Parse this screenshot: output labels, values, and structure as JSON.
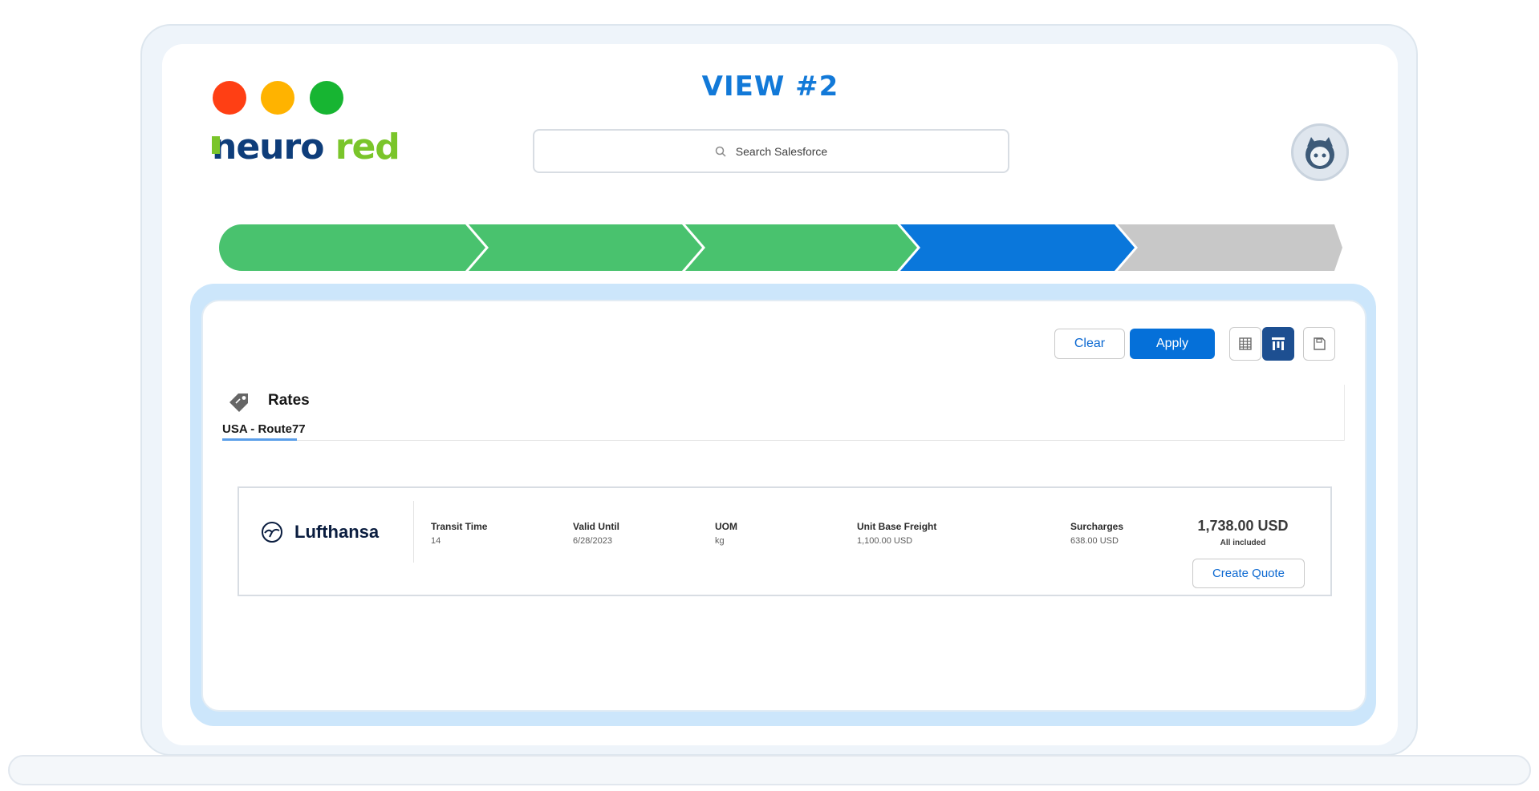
{
  "header": {
    "title": "VIEW #2",
    "logo_part1": "neuro",
    "logo_part2": "red",
    "search_placeholder": "Search Salesforce"
  },
  "path": {
    "stages": [
      {
        "status": "complete",
        "color": "#49c26e"
      },
      {
        "status": "complete",
        "color": "#49c26e"
      },
      {
        "status": "complete",
        "color": "#49c26e"
      },
      {
        "status": "current",
        "color": "#0a77db"
      },
      {
        "status": "incomplete",
        "color": "#c8c8c8"
      }
    ]
  },
  "toolbar": {
    "clear_label": "Clear",
    "apply_label": "Apply",
    "icons": [
      "table-view-icon",
      "column-view-icon",
      "save-icon"
    ]
  },
  "rates": {
    "title": "Rates",
    "tab_label": "USA - Route77",
    "card": {
      "carrier": "Lufthansa",
      "columns": [
        {
          "label": "Transit Time",
          "value": "14"
        },
        {
          "label": "Valid Until",
          "value": "6/28/2023"
        },
        {
          "label": "UOM",
          "value": "kg"
        },
        {
          "label": "Unit Base Freight",
          "value": "1,100.00 USD"
        },
        {
          "label": "Surcharges",
          "value": "638.00 USD"
        }
      ],
      "total": "1,738.00 USD",
      "total_note": "All included",
      "create_quote_label": "Create Quote"
    }
  },
  "colors": {
    "accent": "#0570d9",
    "title": "#1279d8",
    "panel_bg": "#cce6fb"
  }
}
